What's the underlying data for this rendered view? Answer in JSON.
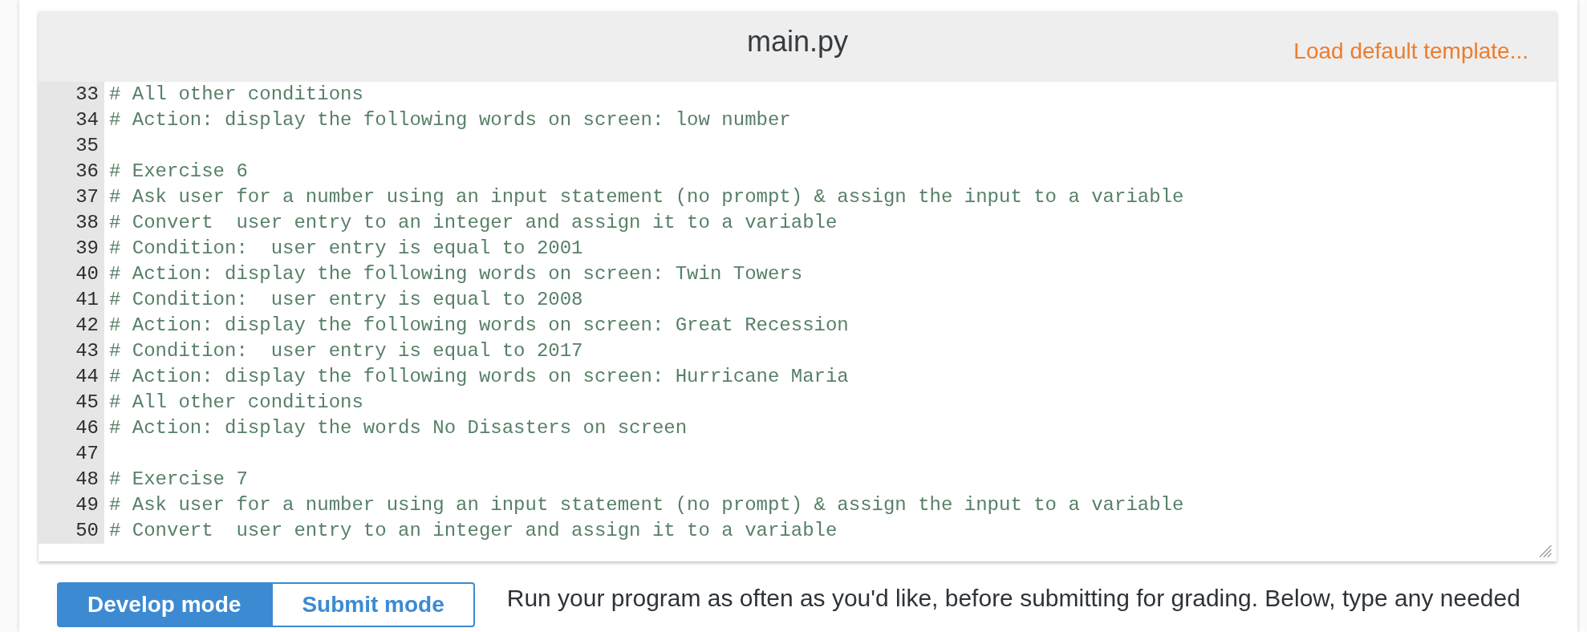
{
  "editor": {
    "title": "main.py",
    "template_link": "Load default template...",
    "lines": [
      {
        "number": "33",
        "text": "# All other conditions"
      },
      {
        "number": "34",
        "text": "# Action: display the following words on screen: low number"
      },
      {
        "number": "35"
      },
      {
        "number": "36",
        "text": "# Exercise 6"
      },
      {
        "number": "37",
        "text": "# Ask user for a number using an input statement (no prompt) & assign the input to a variable"
      },
      {
        "number": "38",
        "text": "# Convert  user entry to an integer and assign it to a variable"
      },
      {
        "number": "39",
        "text": "# Condition:  user entry is equal to 2001"
      },
      {
        "number": "40",
        "text": "# Action: display the following words on screen: Twin Towers"
      },
      {
        "number": "41",
        "text": "# Condition:  user entry is equal to 2008"
      },
      {
        "number": "42",
        "text": "# Action: display the following words on screen: Great Recession"
      },
      {
        "number": "43",
        "text": "# Condition:  user entry is equal to 2017"
      },
      {
        "number": "44",
        "text": "# Action: display the following words on screen: Hurricane Maria"
      },
      {
        "number": "45",
        "text": "# All other conditions"
      },
      {
        "number": "46",
        "text": "# Action: display the words No Disasters on screen"
      },
      {
        "number": "47"
      },
      {
        "number": "48",
        "text": "# Exercise 7"
      },
      {
        "number": "49",
        "text": "# Ask user for a number using an input statement (no prompt) & assign the input to a variable"
      },
      {
        "number": "50",
        "text": "# Convert  user entry to an integer and assign it to a variable"
      }
    ]
  },
  "modes": [
    {
      "label": "Develop mode",
      "selected": true
    },
    {
      "label": "Submit mode",
      "selected": false
    }
  ],
  "instructions": "Run your program as often as you'd like, before submitting for grading. Below, type any needed"
}
